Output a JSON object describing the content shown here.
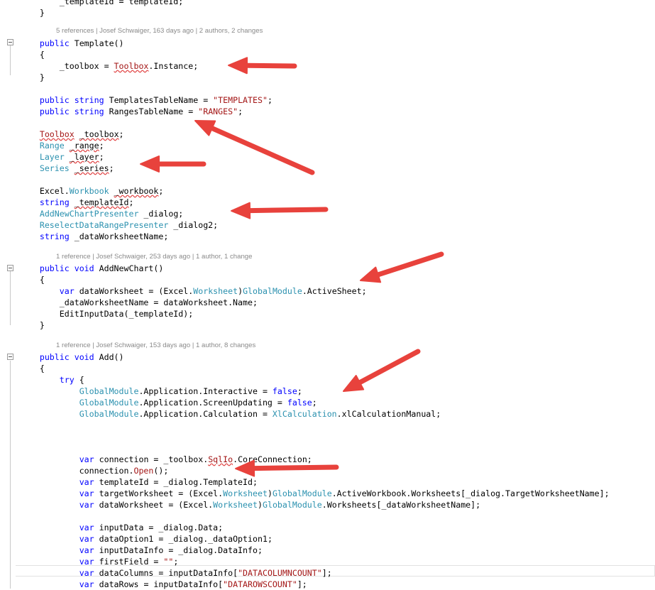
{
  "code": {
    "lines": [
      [
        {
          "t": "            _templateId = templateId;"
        }
      ],
      [
        {
          "t": "        }"
        }
      ],
      [
        {
          "t": ""
        }
      ],
      [
        {
          "t": "        "
        },
        {
          "t": "public",
          "c": "kw"
        },
        {
          "t": " Template()"
        }
      ],
      [
        {
          "t": "        {"
        }
      ],
      [
        {
          "t": "            _toolbox = "
        },
        {
          "t": "Toolbox",
          "c": "st er"
        },
        {
          "t": ".Instance;"
        }
      ],
      [
        {
          "t": "        }"
        }
      ],
      [
        {
          "t": ""
        }
      ],
      [
        {
          "t": "        "
        },
        {
          "t": "public",
          "c": "kw"
        },
        {
          "t": " "
        },
        {
          "t": "string",
          "c": "kw"
        },
        {
          "t": " TemplatesTableName = "
        },
        {
          "t": "\"TEMPLATES\"",
          "c": "st"
        },
        {
          "t": ";"
        }
      ],
      [
        {
          "t": "        "
        },
        {
          "t": "public",
          "c": "kw"
        },
        {
          "t": " "
        },
        {
          "t": "string",
          "c": "kw"
        },
        {
          "t": " RangesTableName = "
        },
        {
          "t": "\"RANGES\"",
          "c": "st"
        },
        {
          "t": ";"
        }
      ],
      [
        {
          "t": ""
        }
      ],
      [
        {
          "t": "        "
        },
        {
          "t": "Toolbox",
          "c": "st er"
        },
        {
          "t": " "
        },
        {
          "t": "_toolbox",
          "c": "er"
        },
        {
          "t": ";"
        }
      ],
      [
        {
          "t": "        "
        },
        {
          "t": "Range",
          "c": "ty"
        },
        {
          "t": " "
        },
        {
          "t": "_range",
          "c": "er"
        },
        {
          "t": ";"
        }
      ],
      [
        {
          "t": "        "
        },
        {
          "t": "Layer",
          "c": "ty"
        },
        {
          "t": " "
        },
        {
          "t": "_layer",
          "c": "er"
        },
        {
          "t": ";"
        }
      ],
      [
        {
          "t": "        "
        },
        {
          "t": "Series",
          "c": "ty"
        },
        {
          "t": " "
        },
        {
          "t": "_series",
          "c": "er"
        },
        {
          "t": ";"
        }
      ],
      [
        {
          "t": ""
        }
      ],
      [
        {
          "t": "        Excel."
        },
        {
          "t": "Workbook",
          "c": "ty"
        },
        {
          "t": " "
        },
        {
          "t": "_workbook",
          "c": "er"
        },
        {
          "t": ";"
        }
      ],
      [
        {
          "t": "        "
        },
        {
          "t": "string",
          "c": "kw"
        },
        {
          "t": " "
        },
        {
          "t": "_templateId",
          "c": "er"
        },
        {
          "t": ";"
        }
      ],
      [
        {
          "t": "        "
        },
        {
          "t": "AddNewChartPresenter",
          "c": "ty"
        },
        {
          "t": " _dialog;"
        }
      ],
      [
        {
          "t": "        "
        },
        {
          "t": "ReselectDataRangePresenter",
          "c": "ty"
        },
        {
          "t": " _dialog2;"
        }
      ],
      [
        {
          "t": "        "
        },
        {
          "t": "string",
          "c": "kw"
        },
        {
          "t": " _dataWorksheetName;"
        }
      ],
      [
        {
          "t": ""
        }
      ],
      [
        {
          "t": "        "
        },
        {
          "t": "public",
          "c": "kw"
        },
        {
          "t": " "
        },
        {
          "t": "void",
          "c": "kw"
        },
        {
          "t": " AddNewChart()"
        }
      ],
      [
        {
          "t": "        {"
        }
      ],
      [
        {
          "t": "            "
        },
        {
          "t": "var",
          "c": "kw"
        },
        {
          "t": " dataWorksheet = (Excel."
        },
        {
          "t": "Worksheet",
          "c": "ty"
        },
        {
          "t": ")"
        },
        {
          "t": "GlobalModule",
          "c": "ty"
        },
        {
          "t": ".ActiveSheet;"
        }
      ],
      [
        {
          "t": "            _dataWorksheetName = dataWorksheet.Name;"
        }
      ],
      [
        {
          "t": "            EditInputData(_templateId);"
        }
      ],
      [
        {
          "t": "        }"
        }
      ],
      [
        {
          "t": ""
        }
      ],
      [
        {
          "t": "        "
        },
        {
          "t": "public",
          "c": "kw"
        },
        {
          "t": " "
        },
        {
          "t": "void",
          "c": "kw"
        },
        {
          "t": " Add()"
        }
      ],
      [
        {
          "t": "        {"
        }
      ],
      [
        {
          "t": "            "
        },
        {
          "t": "try",
          "c": "kw"
        },
        {
          "t": " {"
        }
      ],
      [
        {
          "t": "                "
        },
        {
          "t": "GlobalModule",
          "c": "ty"
        },
        {
          "t": ".Application.Interactive = "
        },
        {
          "t": "false",
          "c": "kw"
        },
        {
          "t": ";"
        }
      ],
      [
        {
          "t": "                "
        },
        {
          "t": "GlobalModule",
          "c": "ty"
        },
        {
          "t": ".Application.ScreenUpdating = "
        },
        {
          "t": "false",
          "c": "kw"
        },
        {
          "t": ";"
        }
      ],
      [
        {
          "t": "                "
        },
        {
          "t": "GlobalModule",
          "c": "ty"
        },
        {
          "t": ".Application.Calculation = "
        },
        {
          "t": "XlCalculation",
          "c": "ty"
        },
        {
          "t": ".xlCalculationManual;"
        }
      ],
      [
        {
          "t": ""
        }
      ],
      [
        {
          "t": ""
        }
      ],
      [
        {
          "t": ""
        }
      ],
      [
        {
          "t": "                "
        },
        {
          "t": "var",
          "c": "kw"
        },
        {
          "t": " connection = _toolbox."
        },
        {
          "t": "SqlIo",
          "c": "st er"
        },
        {
          "t": ".CoreConnection;"
        }
      ],
      [
        {
          "t": "                connection."
        },
        {
          "t": "Open",
          "c": "st"
        },
        {
          "t": "();"
        }
      ],
      [
        {
          "t": "                "
        },
        {
          "t": "var",
          "c": "kw"
        },
        {
          "t": " templateId = _dialog.TemplateId;"
        }
      ],
      [
        {
          "t": "                "
        },
        {
          "t": "var",
          "c": "kw"
        },
        {
          "t": " targetWorksheet = (Excel."
        },
        {
          "t": "Worksheet",
          "c": "ty"
        },
        {
          "t": ")"
        },
        {
          "t": "GlobalModule",
          "c": "ty"
        },
        {
          "t": ".ActiveWorkbook.Worksheets[_dialog.TargetWorksheetName];"
        }
      ],
      [
        {
          "t": "                "
        },
        {
          "t": "var",
          "c": "kw"
        },
        {
          "t": " dataWorksheet = (Excel."
        },
        {
          "t": "Worksheet",
          "c": "ty"
        },
        {
          "t": ")"
        },
        {
          "t": "GlobalModule",
          "c": "ty"
        },
        {
          "t": ".Worksheets[_dataWorksheetName];"
        }
      ],
      [
        {
          "t": ""
        }
      ],
      [
        {
          "t": "                "
        },
        {
          "t": "var",
          "c": "kw"
        },
        {
          "t": " inputData = _dialog.Data;"
        }
      ],
      [
        {
          "t": "                "
        },
        {
          "t": "var",
          "c": "kw"
        },
        {
          "t": " dataOption1 = _dialog._dataOption1;"
        }
      ],
      [
        {
          "t": "                "
        },
        {
          "t": "var",
          "c": "kw"
        },
        {
          "t": " inputDataInfo = _dialog.DataInfo;"
        }
      ],
      [
        {
          "t": "                "
        },
        {
          "t": "var",
          "c": "kw"
        },
        {
          "t": " firstField = "
        },
        {
          "t": "\"\"",
          "c": "st"
        },
        {
          "t": ";"
        }
      ],
      [
        {
          "t": "                "
        },
        {
          "t": "var",
          "c": "kw"
        },
        {
          "t": " dataColumns = inputDataInfo["
        },
        {
          "t": "\"DATACOLUMNCOUNT\"",
          "c": "st"
        },
        {
          "t": "];"
        }
      ],
      [
        {
          "t": "                "
        },
        {
          "t": "var",
          "c": "kw"
        },
        {
          "t": " dataRows = inputDataInfo["
        },
        {
          "t": "\"DATAROWSCOUNT\"",
          "c": "st"
        },
        {
          "t": "];"
        }
      ]
    ],
    "code_lens": [
      {
        "text": "5 references | Josef Schwaiger, 163 days ago | 2 authors, 2 changes"
      },
      {
        "text": "1 reference | Josef Schwaiger, 253 days ago | 1 author, 1 change"
      },
      {
        "text": "1 reference | Josef Schwaiger, 153 days ago | 1 author, 8 changes"
      }
    ]
  },
  "annotations": {
    "arrow_color": "#e8423c",
    "arrow_count": 8
  }
}
